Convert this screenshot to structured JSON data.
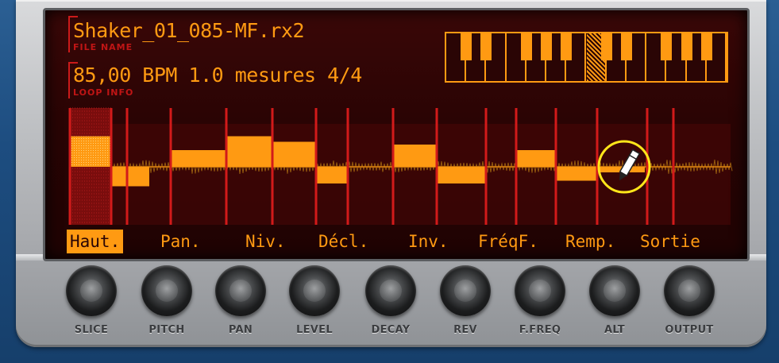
{
  "display": {
    "file_name": "Shaker_01_085-MF.rx2",
    "file_name_label": "FILE NAME",
    "loop_info": "85,00 BPM  1.0 mesures 4/4",
    "loop_info_label": "LOOP INFO"
  },
  "params": {
    "items": [
      "Haut.",
      "Pan.",
      "Niv.",
      "Décl.",
      "Inv.",
      "FréqF.",
      "Remp.",
      "Sortie"
    ],
    "active": "Haut."
  },
  "knobs": {
    "labels": [
      "SLICE",
      "PITCH",
      "PAN",
      "LEVEL",
      "DECAY",
      "REV",
      "F.FREQ",
      "ALT",
      "OUTPUT"
    ]
  },
  "slice_editor": {
    "selected_slice": 1,
    "slice_pitch_levels": [
      0.55,
      -0.35,
      0.3,
      0.55,
      0.45,
      -0.3,
      0.4,
      -0.3,
      0.3,
      -0.25,
      -0.1,
      0,
      0
    ],
    "tool": "pencil-icon"
  },
  "colors": {
    "accent": "#ff9a12",
    "label_red": "#c01515",
    "display_bg": "#2a0404",
    "highlight_ring": "#ffe61a"
  }
}
